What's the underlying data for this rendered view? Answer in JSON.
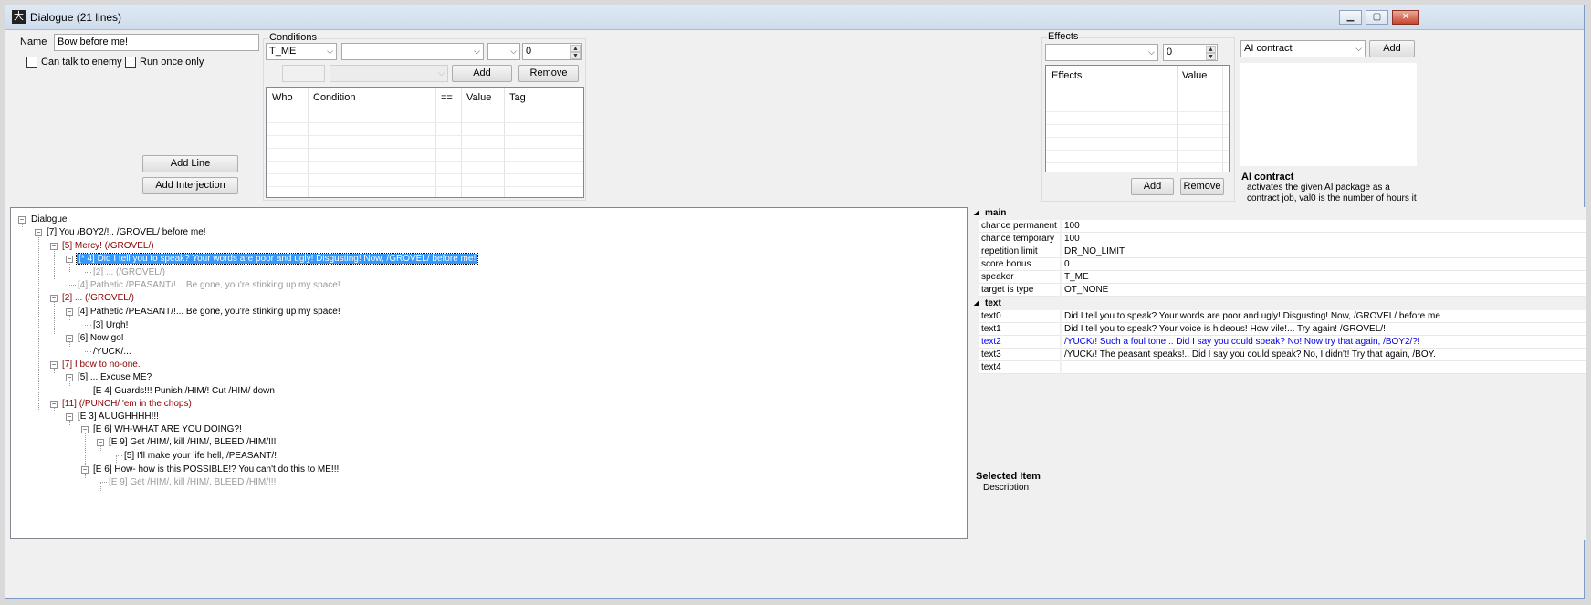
{
  "window": {
    "title": "Dialogue (21 lines)",
    "app_icon_glyph": "大",
    "min_glyph": "▁",
    "max_glyph": "▢",
    "close_glyph": "✕"
  },
  "line_editor": {
    "name_label": "Name",
    "name_value": "Bow before me!",
    "can_talk_to_enemy": "Can talk to enemy",
    "run_once_only": "Run once only",
    "add_line": "Add Line",
    "add_interjection": "Add Interjection"
  },
  "conditions": {
    "group_label": "Conditions",
    "who_value": "T_ME",
    "condition_value": "",
    "compare_value": "",
    "value_value": "0",
    "tag_value": "",
    "option_value": "",
    "add": "Add",
    "remove": "Remove",
    "columns": [
      "Who",
      "Condition",
      "==",
      "Value",
      "Tag"
    ]
  },
  "effects": {
    "group_label": "Effects",
    "effect_value": "",
    "value_value": "0",
    "columns": [
      "Effects",
      "Value"
    ],
    "add": "Add",
    "remove": "Remove"
  },
  "ai": {
    "selected": "AI contract",
    "add": "Add",
    "desc_title": "AI contract",
    "desc_text": "activates the given AI package as a contract job, val0 is the number of hours it"
  },
  "tree": {
    "root": "Dialogue",
    "nodes": [
      "[7] You /BOY2/!.. /GROVEL/ before me!",
      "[5] Mercy! (/GROVEL/)",
      "[* 4] Did I tell you to speak? Your words are poor and ugly! Disgusting! Now, /GROVEL/ before me!",
      "[2] ... (/GROVEL/)",
      "[4] Pathetic /PEASANT/!... Be gone, you're stinking up my space!",
      "[2] ... (/GROVEL/)",
      "[4] Pathetic /PEASANT/!... Be gone, you're stinking up my space!",
      "[3] Urgh!",
      "[6] Now go!",
      "/YUCK/...",
      "[7] I bow to no-one.",
      "[5] ... Excuse ME?",
      "[E 4] Guards!!! Punish /HIM/! Cut /HIM/ down",
      "[11] (/PUNCH/ 'em in the chops)",
      "[E 3] AUUGHHHH!!!",
      "[E 6] WH-WHAT ARE YOU DOING?!",
      "[E 9] Get /HIM/, kill /HIM/, BLEED /HIM/!!!",
      "[5] I'll make your life hell, /PEASANT/!",
      "[E 6] How- how is this POSSIBLE!? You can't do this to ME!!!",
      "[E 9] Get /HIM/, kill /HIM/, BLEED /HIM/!!!"
    ]
  },
  "properties": {
    "main_label": "main",
    "main": [
      {
        "key": "chance permanent",
        "value": "100"
      },
      {
        "key": "chance temporary",
        "value": "100"
      },
      {
        "key": "repetition limit",
        "value": "DR_NO_LIMIT"
      },
      {
        "key": "score bonus",
        "value": "0"
      },
      {
        "key": "speaker",
        "value": "T_ME"
      },
      {
        "key": "target is type",
        "value": "OT_NONE"
      }
    ],
    "text_label": "text",
    "text": [
      {
        "key": "text0",
        "value": "Did I tell you to speak? Your words are poor and ugly! Disgusting! Now, /GROVEL/ before me"
      },
      {
        "key": "text1",
        "value": "Did I tell you to speak? Your voice is hideous! How vile!... Try again! /GROVEL/!"
      },
      {
        "key": "text2",
        "value": "/YUCK/! Such a foul tone!.. Did I say you could speak? No! Now try that again, /BOY2/?!"
      },
      {
        "key": "text3",
        "value": "/YUCK/! The peasant speaks!.. Did I say you could speak? No, I didn't! Try that again, /BOY."
      },
      {
        "key": "text4",
        "value": ""
      }
    ],
    "selected_title": "Selected Item",
    "selected_desc": "Description"
  },
  "colors": {
    "selection": "#3399ff",
    "red_node": "#8b0000",
    "gray_node": "#9a9a9a",
    "blue_text": "#0000e0"
  }
}
